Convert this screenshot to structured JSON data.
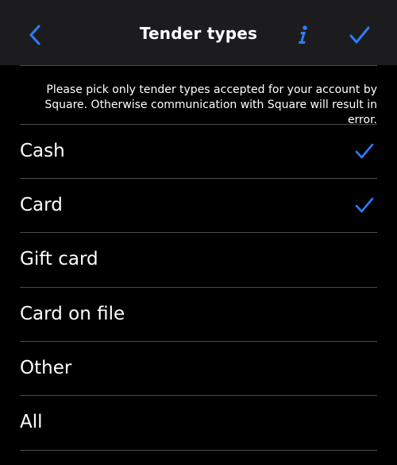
{
  "navbar": {
    "title": "Tender types",
    "back_icon": "chevron-left-icon",
    "info_icon": "info-icon",
    "done_icon": "checkmark-icon",
    "accent_color": "#2f7cf6"
  },
  "notice": {
    "text": "Please pick only tender types accepted for your account by Square. Otherwise communication with Square will result in error."
  },
  "tender_types": [
    {
      "label": "Cash",
      "selected": true
    },
    {
      "label": "Card",
      "selected": true
    },
    {
      "label": "Gift card",
      "selected": false
    },
    {
      "label": "Card on file",
      "selected": false
    },
    {
      "label": "Other",
      "selected": false
    },
    {
      "label": "All",
      "selected": false
    }
  ]
}
